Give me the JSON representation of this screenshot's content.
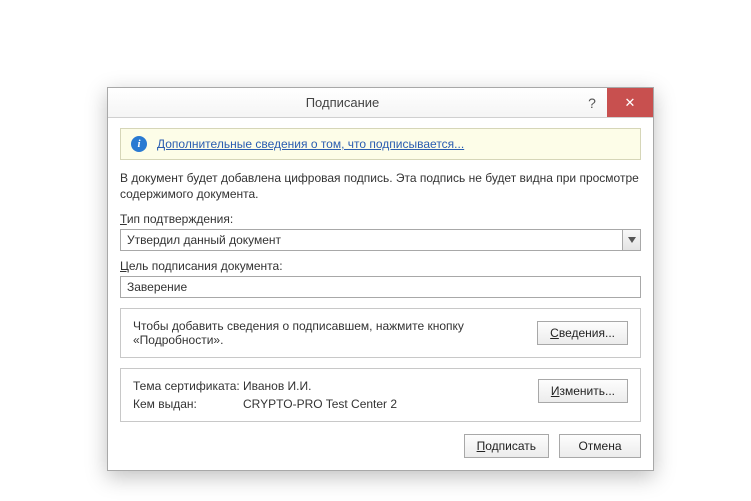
{
  "title": "Подписание",
  "info_link": "Дополнительные сведения о том, что подписывается...",
  "description": "В документ будет добавлена цифровая подпись. Эта подпись не будет видна при просмотре содержимого документа.",
  "type_label": "Тип подтверждения:",
  "type_value": "Утвердил данный документ",
  "purpose_label": "Цель подписания документа:",
  "purpose_value": "Заверение",
  "details_hint": "Чтобы добавить сведения о подписавшем, нажмите кнопку «Подробности».",
  "details_button": "Сведения...",
  "cert": {
    "subject_label": "Тема сертификата:",
    "subject_value": "Иванов И.И.",
    "issuer_label": "Кем выдан:",
    "issuer_value": "CRYPTO-PRO Test Center 2",
    "change_button": "Изменить..."
  },
  "sign_button": "Подписать",
  "cancel_button": "Отмена"
}
